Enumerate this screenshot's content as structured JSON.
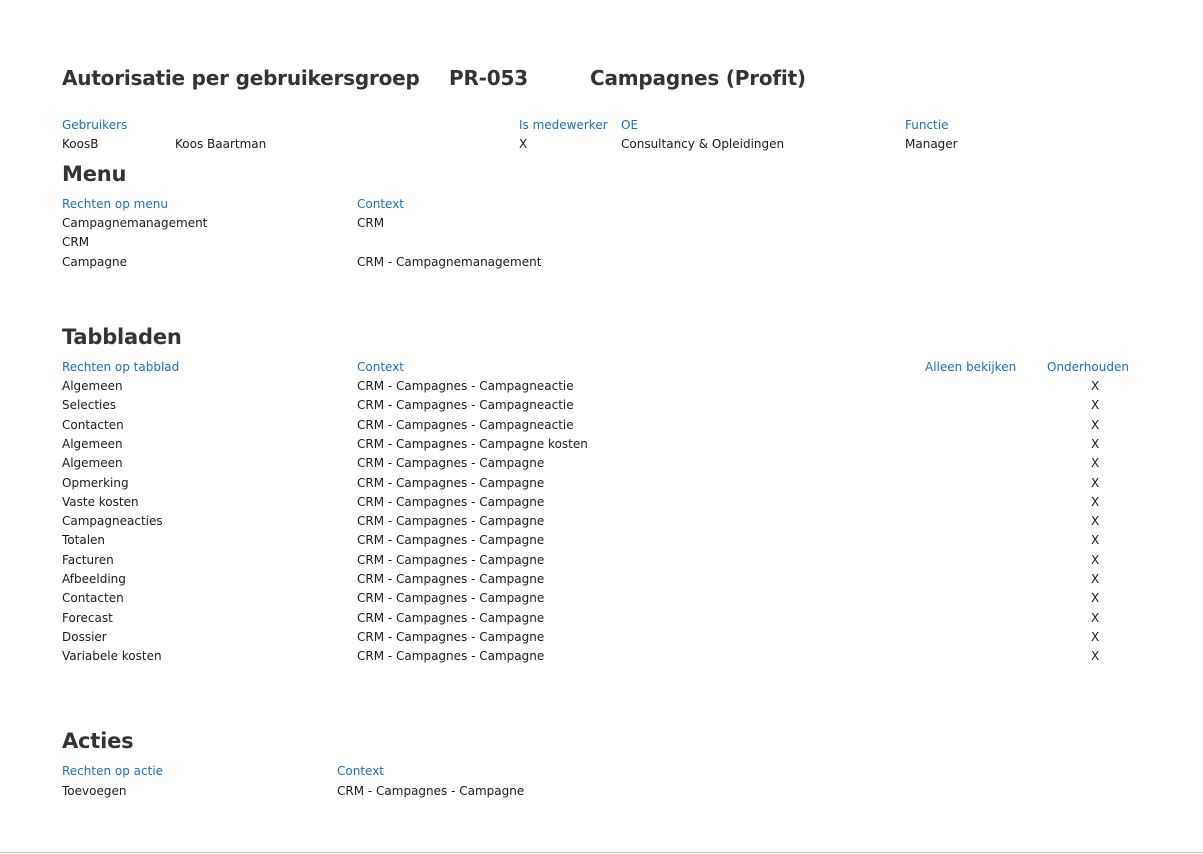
{
  "header": {
    "title": "Autorisatie per gebruikersgroep",
    "code": "PR-053",
    "subject": "Campagnes (Profit)"
  },
  "users": {
    "headers": {
      "users": "Gebruikers",
      "is_employee": "Is medewerker",
      "oe": "OE",
      "function": "Functie"
    },
    "row": {
      "username": "KoosB",
      "fullname": "Koos Baartman",
      "is_employee": "X",
      "oe": "Consultancy & Opleidingen",
      "function": "Manager"
    }
  },
  "menu": {
    "title": "Menu",
    "headers": {
      "rights": "Rechten op menu",
      "context": "Context"
    },
    "rows": [
      {
        "name": "Campagnemanagement",
        "context": "CRM"
      },
      {
        "name": "CRM",
        "context": ""
      },
      {
        "name": "Campagne",
        "context": "CRM - Campagnemanagement"
      }
    ]
  },
  "tabs": {
    "title": "Tabbladen",
    "headers": {
      "rights": "Rechten op tabblad",
      "context": "Context",
      "view_only": "Alleen bekijken",
      "maintain": "Onderhouden"
    },
    "rows": [
      {
        "name": "Algemeen",
        "context": "CRM - Campagnes - Campagneactie",
        "view": "",
        "maintain": "X"
      },
      {
        "name": "Selecties",
        "context": "CRM - Campagnes - Campagneactie",
        "view": "",
        "maintain": "X"
      },
      {
        "name": "Contacten",
        "context": "CRM - Campagnes - Campagneactie",
        "view": "",
        "maintain": "X"
      },
      {
        "name": "Algemeen",
        "context": "CRM - Campagnes - Campagne kosten",
        "view": "",
        "maintain": "X"
      },
      {
        "name": "Algemeen",
        "context": "CRM - Campagnes - Campagne",
        "view": "",
        "maintain": "X"
      },
      {
        "name": "Opmerking",
        "context": "CRM - Campagnes - Campagne",
        "view": "",
        "maintain": "X"
      },
      {
        "name": "Vaste kosten",
        "context": "CRM - Campagnes - Campagne",
        "view": "",
        "maintain": "X"
      },
      {
        "name": "Campagneacties",
        "context": "CRM - Campagnes - Campagne",
        "view": "",
        "maintain": "X"
      },
      {
        "name": "Totalen",
        "context": "CRM - Campagnes - Campagne",
        "view": "",
        "maintain": "X"
      },
      {
        "name": "Facturen",
        "context": "CRM - Campagnes - Campagne",
        "view": "",
        "maintain": "X"
      },
      {
        "name": "Afbeelding",
        "context": "CRM - Campagnes - Campagne",
        "view": "",
        "maintain": "X"
      },
      {
        "name": "Contacten",
        "context": "CRM - Campagnes - Campagne",
        "view": "",
        "maintain": "X"
      },
      {
        "name": "Forecast",
        "context": "CRM - Campagnes - Campagne",
        "view": "",
        "maintain": "X"
      },
      {
        "name": "Dossier",
        "context": "CRM - Campagnes - Campagne",
        "view": "",
        "maintain": "X"
      },
      {
        "name": "Variabele kosten",
        "context": "CRM - Campagnes - Campagne",
        "view": "",
        "maintain": "X"
      }
    ]
  },
  "actions": {
    "title": "Acties",
    "headers": {
      "rights": "Rechten op actie",
      "context": "Context"
    },
    "rows": [
      {
        "name": "Toevoegen",
        "context": "CRM - Campagnes - Campagne"
      }
    ]
  }
}
